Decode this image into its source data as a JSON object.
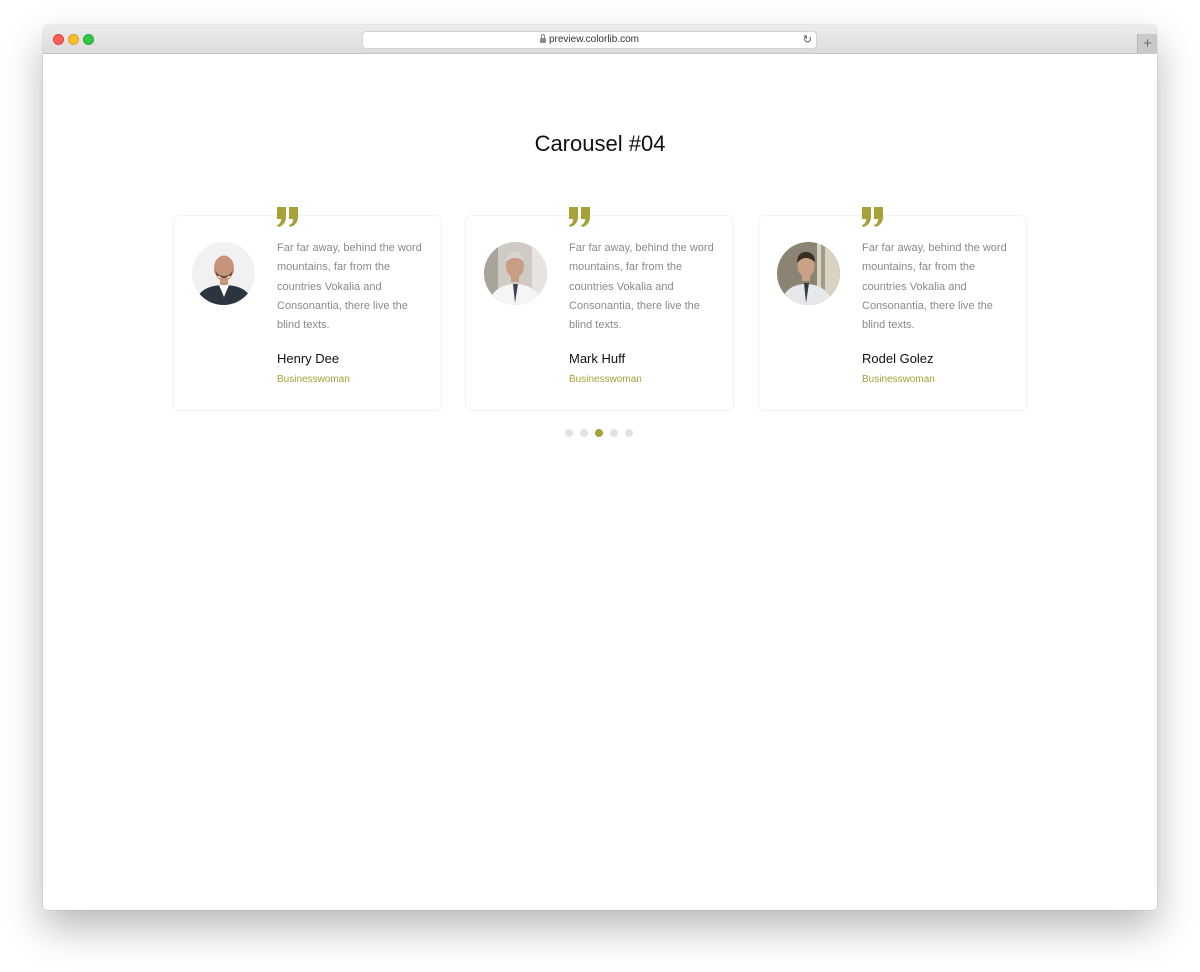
{
  "browser": {
    "url": "preview.colorlib.com",
    "newtab_label": "+"
  },
  "page": {
    "title": "Carousel #04"
  },
  "colors": {
    "accent": "#a8a038",
    "body_text": "#8a8a8a",
    "heading": "#111111"
  },
  "testimonials": [
    {
      "text": "Far far away, behind the word mountains, far from the countries Vokalia and Consonantia, there live the blind texts.",
      "name": "Henry Dee",
      "role": "Businesswoman",
      "icon": "quote-icon"
    },
    {
      "text": "Far far away, behind the word mountains, far from the countries Vokalia and Consonantia, there live the blind texts.",
      "name": "Mark Huff",
      "role": "Businesswoman",
      "icon": "quote-icon"
    },
    {
      "text": "Far far away, behind the word mountains, far from the countries Vokalia and Consonantia, there live the blind texts.",
      "name": "Rodel Golez",
      "role": "Businesswoman",
      "icon": "quote-icon"
    }
  ],
  "carousel": {
    "dot_count": 5,
    "active_dot": 3
  }
}
